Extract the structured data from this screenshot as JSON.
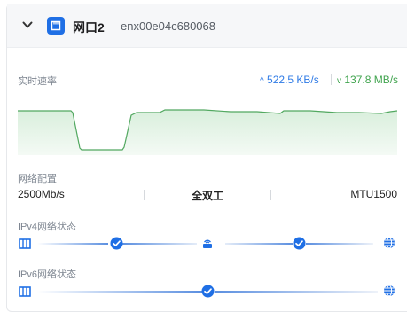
{
  "header": {
    "port_name": "网口2",
    "interface_id": "enx00e04c680068"
  },
  "realtime": {
    "label": "实时速率",
    "upload": "522.5 KB/s",
    "download": "137.8 MB/s",
    "colors": {
      "upload": "#2f7be6",
      "download": "#3fa34d",
      "area": "#e4f3e6",
      "line": "#52a860"
    }
  },
  "config": {
    "label": "网络配置",
    "speed": "2500Mb/s",
    "duplex": "全双工",
    "mtu": "MTU1500"
  },
  "ipv4": {
    "label": "IPv4网络状态",
    "nodes": [
      "port-icon",
      "check-icon",
      "router-icon",
      "check-icon",
      "globe-icon"
    ]
  },
  "ipv6": {
    "label": "IPv6网络状态",
    "nodes": [
      "port-icon",
      "check-icon",
      "globe-icon"
    ]
  },
  "accent": "#1f6fe5"
}
